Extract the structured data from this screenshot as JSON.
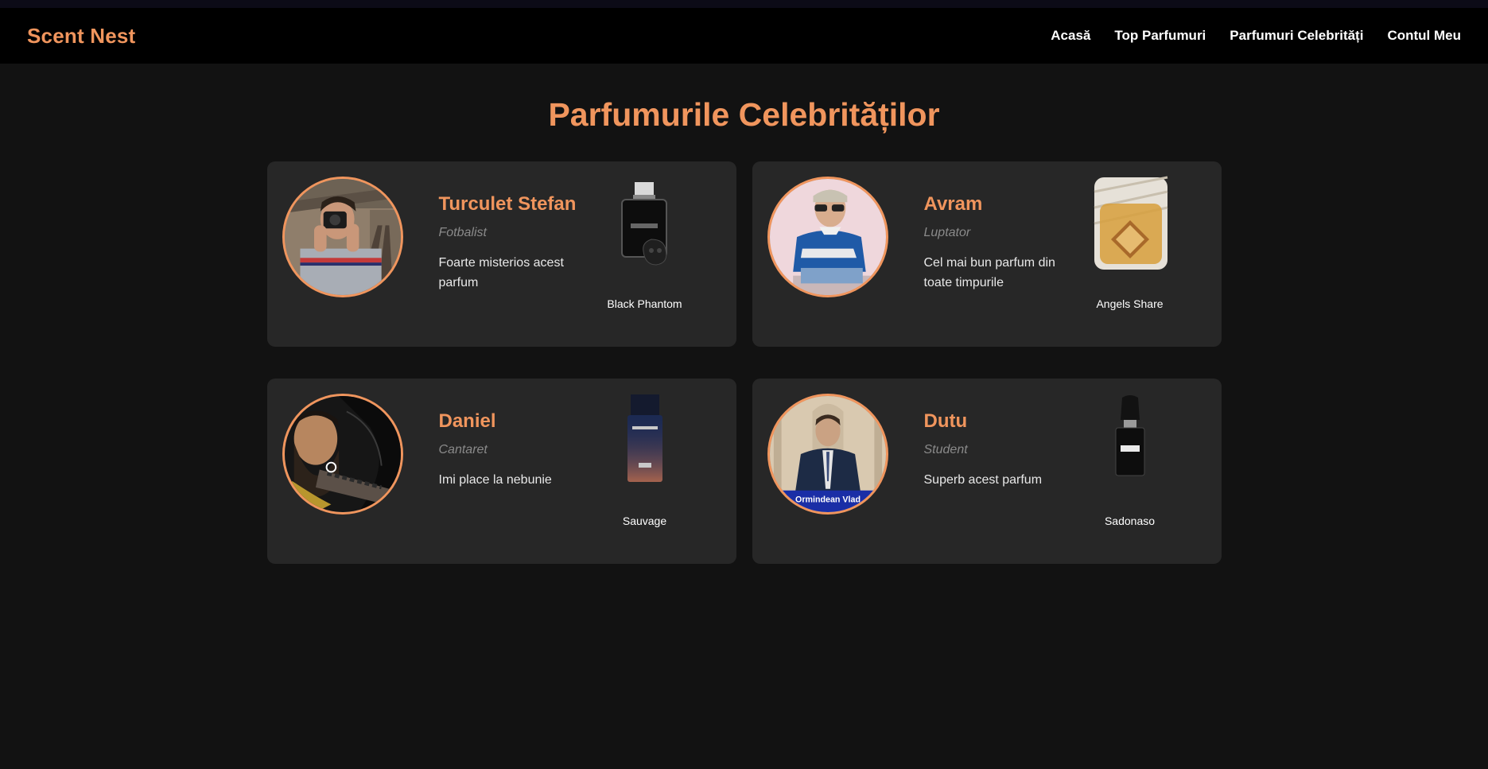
{
  "nav": {
    "brand": "Scent Nest",
    "links": [
      "Acasă",
      "Top Parfumuri",
      "Parfumuri Celebrități",
      "Contul Meu"
    ]
  },
  "page": {
    "title": "Parfumurile Celebrităților"
  },
  "celebrities": [
    {
      "name": "Turculet Stefan",
      "role": "Fotbalist",
      "quote": "Foarte misterios acest parfum",
      "perfume": "Black Phantom"
    },
    {
      "name": "Avram",
      "role": "Luptator",
      "quote": "Cel mai bun parfum din toate timpurile",
      "perfume": "Angels Share"
    },
    {
      "name": "Daniel",
      "role": "Cantaret",
      "quote": "Imi place la nebunie",
      "perfume": "Sauvage"
    },
    {
      "name": "Dutu",
      "role": "Student",
      "quote": "Superb acest parfum",
      "perfume": "Sadonaso",
      "photo_caption": "Ormindean Vlad"
    }
  ],
  "colors": {
    "accent": "#f0955d",
    "background": "#121212",
    "card": "#272727",
    "navbar": "#000000"
  }
}
